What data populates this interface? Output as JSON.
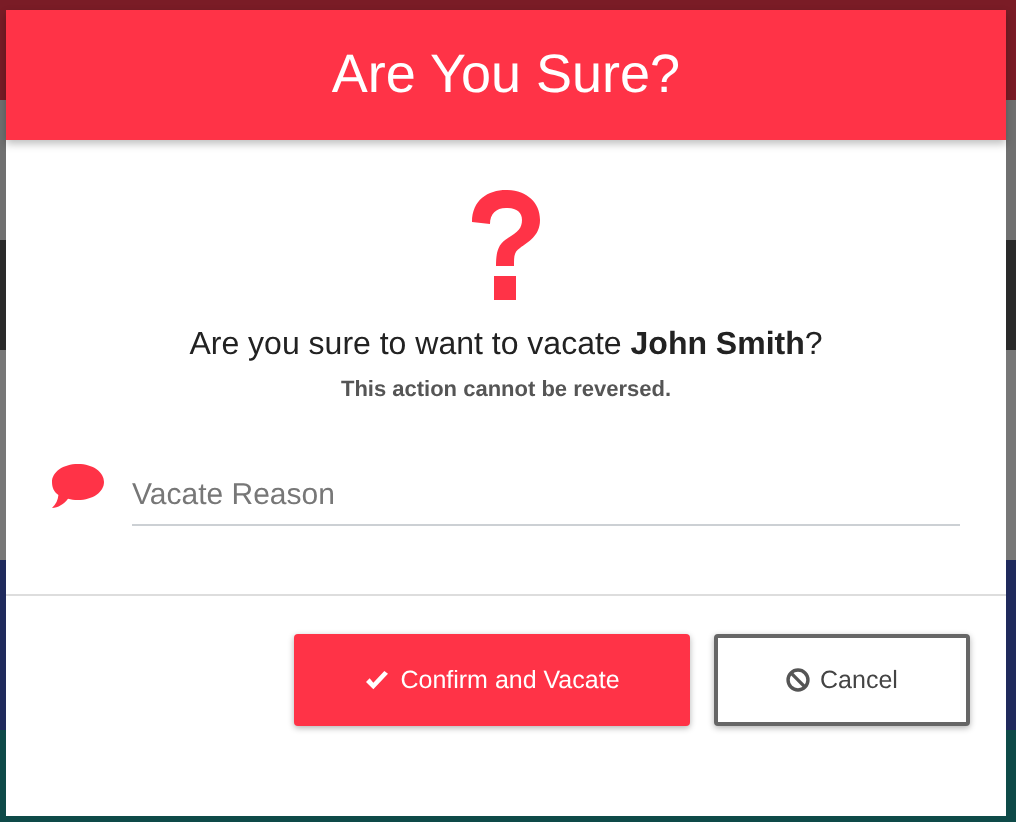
{
  "dialog": {
    "title": "Are You Sure?",
    "message": "Are you sure to want to vacate **John Smith**?",
    "warning": "This action cannot be reversed.",
    "reason_field": {
      "placeholder": "Vacate Reason"
    },
    "buttons": [
      {
        "kind": "primary",
        "label": "Confirm and Vacate"
      },
      {
        "kind": "secondary",
        "label": "Cancel"
      }
    ]
  }
}
